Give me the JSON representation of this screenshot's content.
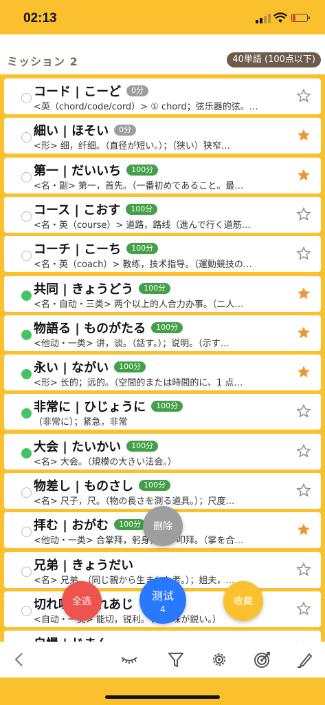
{
  "status_bar": {
    "time": "02:13"
  },
  "header": {
    "title": "ミッション 2",
    "badge": "40単語 (100点以下)"
  },
  "colors": {
    "accent": "#FBC02D",
    "star_on": "#F0962E",
    "done": "#43C463"
  },
  "items": [
    {
      "word": "コード | こーど",
      "score": "0分",
      "desc": "<英（chord/code/cord）> ① chord；弦乐器的弦。…",
      "done": false,
      "fav": false
    },
    {
      "word": "細い | ほそい",
      "score": "0分",
      "desc": "<形> 细，纤细。（直径が短い。）；（狭い）狭窄…",
      "done": false,
      "fav": true
    },
    {
      "word": "第一 | だいいち",
      "score": "100分",
      "desc": "<名・副> 第一，首先。（一番初めであること。最…",
      "done": false,
      "fav": true
    },
    {
      "word": "コース | こおす",
      "score": "100分",
      "desc": "<名・英（course）> 道路，路线（進んで行く道筋…",
      "done": false,
      "fav": false
    },
    {
      "word": "コーチ | こーち",
      "score": "100分",
      "desc": "<名・英（coach）> 教练，技术指导。（運動競技の…",
      "done": false,
      "fav": false
    },
    {
      "word": "共同 | きょうどう",
      "score": "100分",
      "desc": "<名・自动・三类> 两个以上的人合力办事。（二人…",
      "done": true,
      "fav": true
    },
    {
      "word": "物語る | ものがたる",
      "score": "100分",
      "desc": "<他动・一类> 讲，谈。（話す。）；说明。（示す…",
      "done": true,
      "fav": true
    },
    {
      "word": "永い | ながい",
      "score": "100分",
      "desc": "<形> 长的；远的。（空間的または時間的に、1 点…",
      "done": true,
      "fav": true
    },
    {
      "word": "非常に | ひじょうに",
      "score": "100分",
      "desc": "（非常に）；紧急，非常",
      "done": true,
      "fav": false
    },
    {
      "word": "大会 | たいかい",
      "score": "100分",
      "desc": "<名> 大会。（規模の大きい法会。）",
      "done": true,
      "fav": false
    },
    {
      "word": "物差し | ものさし",
      "score": "100分",
      "desc": "<名> 尺子，尺。（物の長さを測る道具。）；尺度…",
      "done": false,
      "fav": false
    },
    {
      "word": "拝む | おがむ",
      "score": "100分",
      "desc": "<他动・一类> 合掌拜，躬身行礼，叩拜。（掌を合…",
      "done": false,
      "fav": true
    },
    {
      "word": "兄弟 | きょうだい",
      "score": "",
      "desc": "<名> 兄弟。（同じ親から生まれた者。）；姐夫，…",
      "done": false,
      "fav": false
    },
    {
      "word": "切れ味 | きれあじ",
      "score": "",
      "desc": "<自动・一类> 能切，锐利。（切れ味が鋭い。）",
      "done": false,
      "fav": false
    },
    {
      "word": "自慢 | じまん",
      "score": "",
      "desc": "",
      "done": false,
      "fav": false
    }
  ],
  "fabs": {
    "delete": "删除",
    "select_all": "全选",
    "test": "测试",
    "test_count": "4",
    "favorite": "收藏"
  },
  "toolbar_icons": [
    "back-icon",
    "eye-closed-icon",
    "filter-icon",
    "gear-icon",
    "target-icon",
    "pencil-icon"
  ]
}
